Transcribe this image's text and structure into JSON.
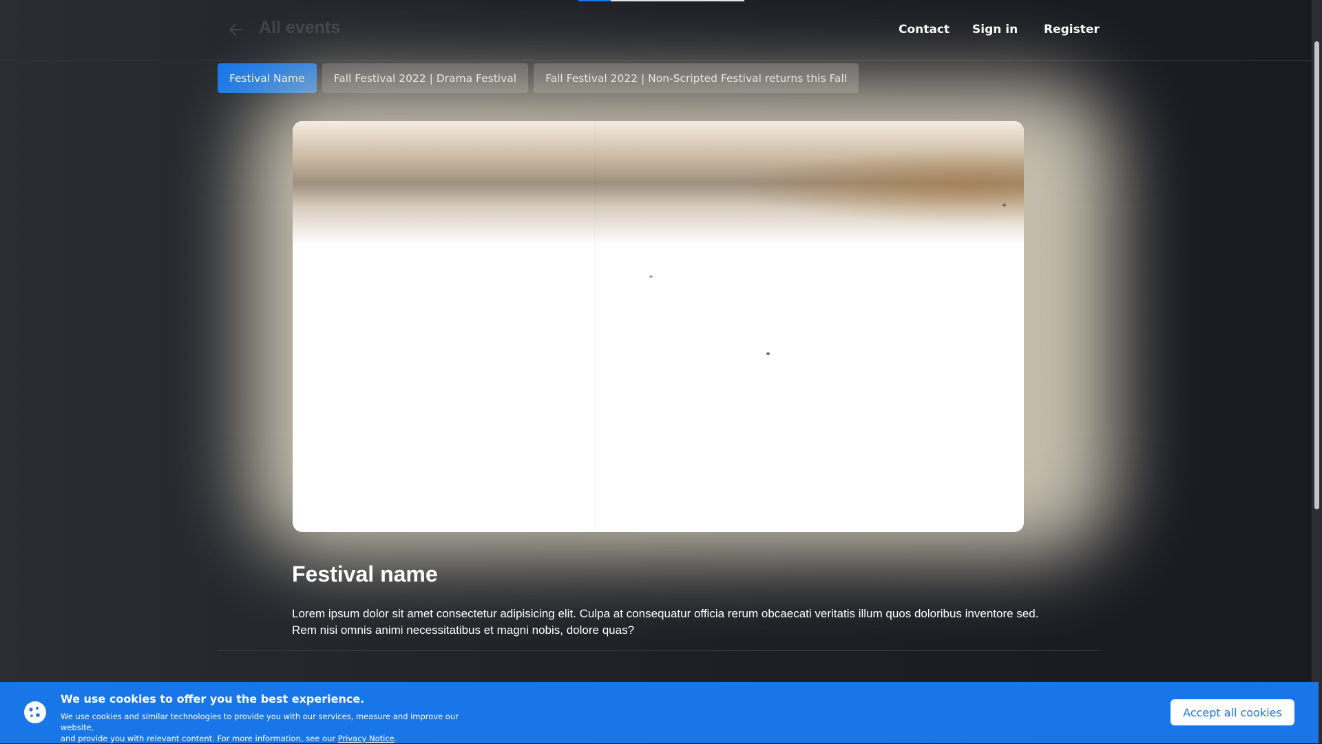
{
  "header": {
    "back_icon": "arrow-left-icon",
    "back_label": "All events",
    "nav": {
      "contact": "Contact",
      "sign_in": "Sign in",
      "register": "Register"
    }
  },
  "tabs": [
    {
      "label": "Festival Name",
      "active": true
    },
    {
      "label": "Fall Festival 2022 | Drama Festival",
      "active": false
    },
    {
      "label": "Fall Festival 2022 | Non-Scripted Festival returns this Fall",
      "active": false
    }
  ],
  "festival": {
    "title": "Festival name",
    "description": "Lorem ipsum dolor sit amet consectetur adipisicing elit. Culpa at consequatur officia rerum obcaecati veritatis illum quos doloribus inventore sed. Rem nisi omnis animi necessitatibus et magni nobis, dolore quas?"
  },
  "cookie_banner": {
    "icon": "cookie-icon",
    "title": "We use cookies to offer you the best experience.",
    "text_line1": "We use cookies and similar technologies to provide you with our services, measure and improve our website,",
    "text_line2_prefix": "and provide you with relevant content. For more information, see our",
    "privacy_link": "Privacy Notice",
    "text_line2_suffix": ".",
    "accept_label": "Accept all cookies"
  },
  "colors": {
    "accent": "#1677e8",
    "tab_inactive": "#4b4d52",
    "background": "#1c1e24"
  }
}
